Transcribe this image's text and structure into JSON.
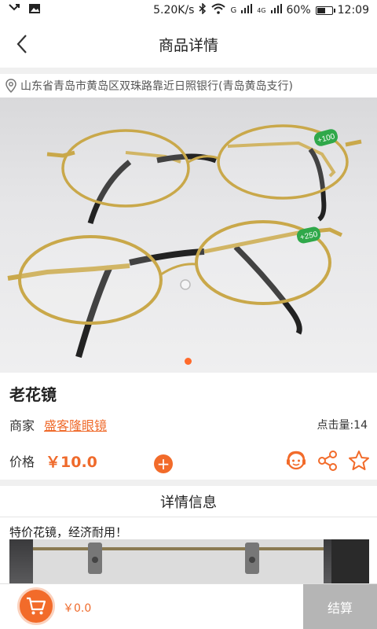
{
  "status_bar": {
    "speed": "5.20K/s",
    "signal_label": "G",
    "network_type": "4G",
    "battery_text": "60%",
    "battery_level": 0.6,
    "time": "12:09"
  },
  "header": {
    "title": "商品详情"
  },
  "address": "山东省青岛市黄岛区双珠路靠近日照银行(青岛黄岛支行)",
  "product": {
    "lens_label_top": "+100",
    "lens_label_bottom": "+250",
    "name": "老花镜",
    "merchant_label": "商家",
    "merchant_name": "盛客隆眼镜",
    "click_count": "点击量:14",
    "price_label": "价格",
    "price": "￥10.0",
    "add_symbol": "+"
  },
  "details": {
    "title": "详情信息",
    "text": "特价花镜，经济耐用！"
  },
  "bottom_bar": {
    "cart_total": "￥0.0",
    "checkout_label": "结算"
  },
  "colors": {
    "accent": "#f26b2a",
    "checkout_bg": "#b5b5b5"
  },
  "icons": [
    "back-arrow-icon",
    "location-pin-icon",
    "customer-service-icon",
    "share-icon",
    "star-icon",
    "cart-icon"
  ]
}
